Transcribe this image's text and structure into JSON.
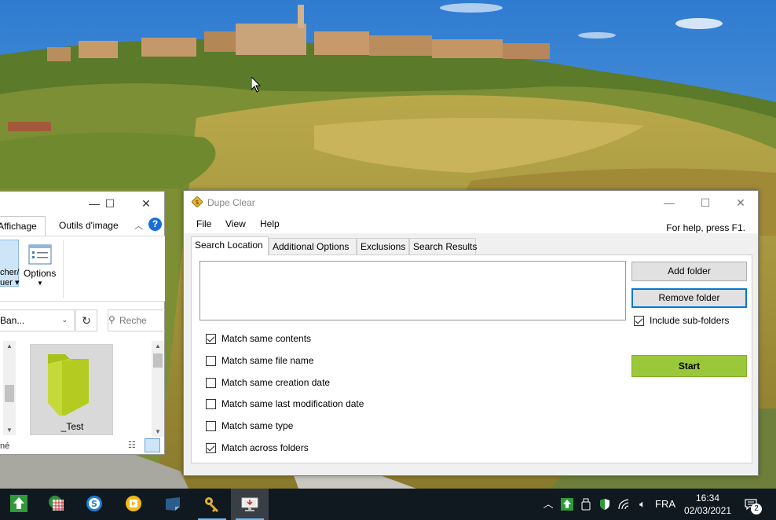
{
  "explorer": {
    "tab_view": "Affichage",
    "tab_tools": "Outils d'image",
    "ribbon_left_label_line1": "cher/",
    "ribbon_left_label_line2": "uer",
    "ribbon_options_label": "Options",
    "address_text": "Ban...",
    "search_placeholder": "Reche",
    "file_name": "_Test",
    "status_text": "né"
  },
  "dupe_clear": {
    "title": "Dupe Clear",
    "menu": [
      "File",
      "View",
      "Help"
    ],
    "help_hint": "For help, press F1.",
    "tabs": [
      "Search Location",
      "Additional Options",
      "Exclusions",
      "Search Results"
    ],
    "active_tab": "Search Location",
    "folders": [],
    "add_folder_label": "Add folder",
    "remove_folder_label": "Remove folder",
    "include_subfolders": {
      "label": "Include sub-folders",
      "checked": true
    },
    "start_label": "Start",
    "match_options": [
      {
        "label": "Match same contents",
        "checked": true
      },
      {
        "label": "Match same file name",
        "checked": false
      },
      {
        "label": "Match same creation date",
        "checked": false
      },
      {
        "label": "Match same last modification date",
        "checked": false
      },
      {
        "label": "Match same type",
        "checked": false
      },
      {
        "label": "Match across folders",
        "checked": true
      }
    ],
    "colors": {
      "start_button": "#9ac83a",
      "focus_border": "#0078d7"
    }
  },
  "taskbar": {
    "apps": [
      {
        "name": "green-upload-app-icon",
        "running": false
      },
      {
        "name": "calculator-grid-app-icon",
        "running": false
      },
      {
        "name": "blue-s-app-icon",
        "running": false
      },
      {
        "name": "media-player-app-icon",
        "running": false
      },
      {
        "name": "sticky-notes-app-icon",
        "running": false
      },
      {
        "name": "key-app-icon",
        "running": true
      },
      {
        "name": "dupe-clear-app-icon",
        "running": true
      }
    ],
    "language": "FRA",
    "time": "16:34",
    "date": "02/03/2021",
    "notification_count": "2"
  }
}
